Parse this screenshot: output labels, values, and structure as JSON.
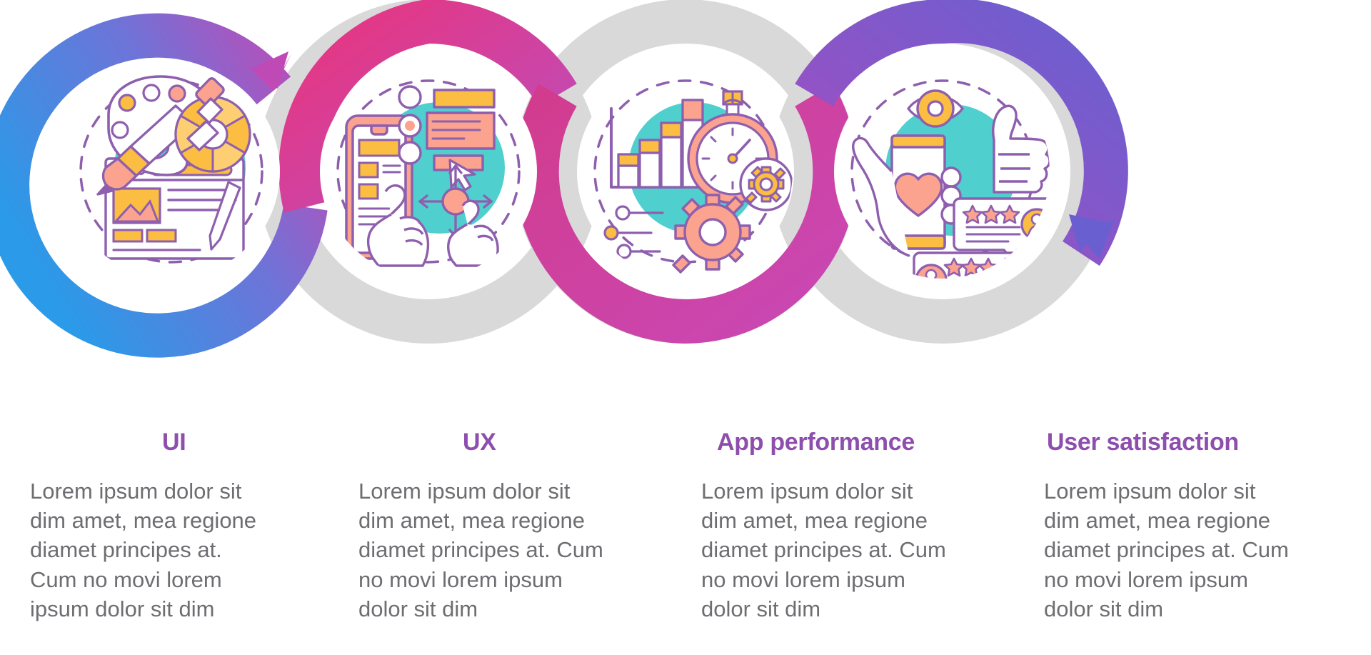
{
  "infographic": {
    "type": "4-step wave/serpentine process infographic",
    "steps": [
      {
        "index": 1,
        "title": "UI",
        "body": "Lorem ipsum dolor sit dim amet, mea regione diamet principes at. Cum no movi lorem ipsum dolor sit dim",
        "icon_name": "ui-design-icon",
        "icon_elements": [
          "paint-palette-icon",
          "paint-brush-icon",
          "color-wheel-icon",
          "eyedropper-icon",
          "browser-window-icon",
          "pencil-icon",
          "image-placeholder-icon"
        ],
        "ribbon_color_start": "#2b9ae8",
        "ribbon_color_end": "#b059c0",
        "accent_circle_color": "#58d3d3"
      },
      {
        "index": 2,
        "title": "UX",
        "body": "Lorem ipsum dolor sit dim amet, mea regione diamet principes at. Cum no movi lorem ipsum dolor sit dim",
        "icon_name": "ux-experience-icon",
        "icon_elements": [
          "smartphone-icon",
          "hand-tap-icon",
          "cursor-arrow-icon",
          "wireframe-card-icon",
          "radio-bullet-icon",
          "four-way-arrow-icon"
        ],
        "ribbon_color_start": "#e83b86",
        "ribbon_color_end": "#d9d9d9",
        "accent_circle_color": "#58d3d3"
      },
      {
        "index": 3,
        "title": "App performance",
        "body": "Lorem ipsum dolor sit dim amet, mea regione diamet principes at. Cum no movi lorem ipsum dolor sit dim",
        "icon_name": "app-performance-icon",
        "icon_elements": [
          "bar-chart-icon",
          "stopwatch-icon",
          "gear-icon",
          "node-graph-icon"
        ],
        "ribbon_color_start": "#d9d9d9",
        "ribbon_color_end": "#c648b0",
        "accent_circle_color": "#58d3d3"
      },
      {
        "index": 4,
        "title": "User satisfaction",
        "body": "Lorem ipsum dolor sit dim amet, mea regione diamet principes at. Cum no movi lorem ipsum dolor sit dim",
        "icon_name": "user-satisfaction-icon",
        "icon_elements": [
          "eye-icon",
          "smartphone-heart-icon",
          "thumbs-up-icon",
          "star-rating-icon",
          "review-bubble-icon",
          "avatar-icon"
        ],
        "ribbon_color_start": "#9b4fc4",
        "ribbon_color_end": "#6a5fd0",
        "accent_circle_color": "#58d3d3"
      }
    ],
    "palette": {
      "heading_purple": "#8e4ead",
      "body_gray": "#6e6e72",
      "ribbon_blue": "#2b9ae8",
      "ribbon_purple": "#9a55c4",
      "ribbon_pink": "#e8357f",
      "ribbon_magenta": "#c948b5",
      "ribbon_violet": "#6a5fd0",
      "ribbon_gray": "#d9d9d9",
      "icon_outline": "#8e5fae",
      "icon_yellow": "#fbbd42",
      "icon_light_yellow": "#fdcf72",
      "icon_salmon": "#fba38f",
      "icon_teal": "#4fd0cf",
      "background": "#ffffff"
    }
  }
}
